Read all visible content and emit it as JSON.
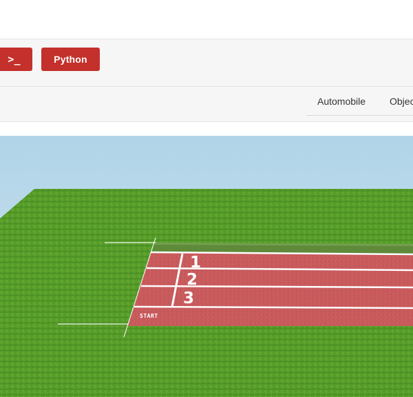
{
  "toolbar": {
    "terminal_icon": "terminal-icon",
    "terminal_glyph": ">_",
    "python_label": "Python",
    "accent_color": "#c4302b"
  },
  "tabs": [
    {
      "label": "Automobile"
    },
    {
      "label": "Objects"
    }
  ],
  "scene": {
    "lanes": [
      "1",
      "2",
      "3"
    ],
    "start_label": "START",
    "colors": {
      "sky": "#b6d8ea",
      "grass": "#5a9e2a",
      "track": "#c8585a",
      "line": "#ffffff"
    }
  }
}
